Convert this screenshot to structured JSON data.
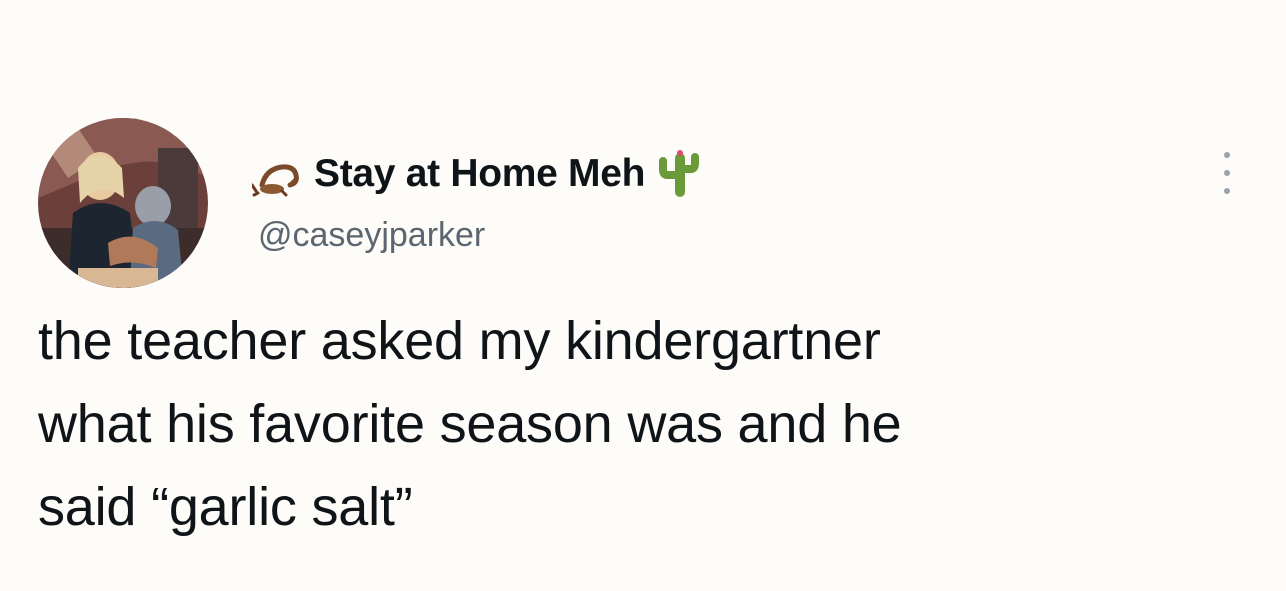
{
  "tweet": {
    "author": {
      "display_name": "Stay at Home Meh",
      "handle": "@caseyjparker",
      "name_prefix_icon": "scorpion-icon",
      "name_suffix_icon": "cactus-icon"
    },
    "text_lines": [
      "the teacher asked my kindergartner",
      "what his favorite season was and he",
      "said “garlic salt”"
    ],
    "more_icon": "more-vertical-icon"
  },
  "colors": {
    "background": "#fdfcf8",
    "text": "#0f1419",
    "handle": "#5b6670",
    "cactus": "#6a9a3a"
  }
}
